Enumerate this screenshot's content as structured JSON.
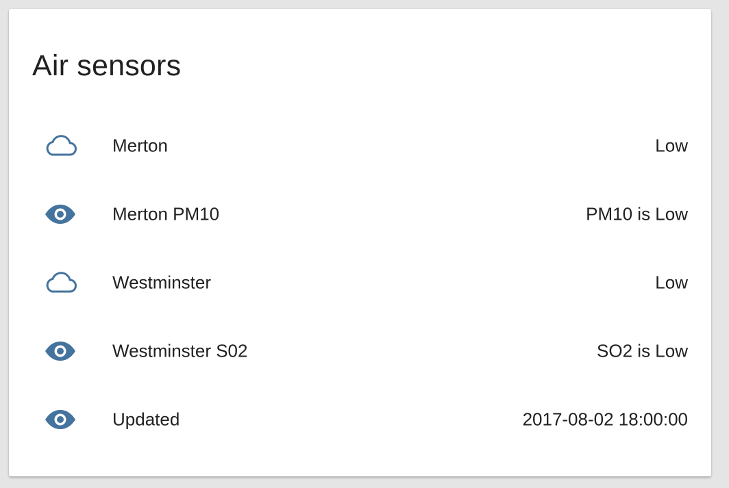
{
  "card": {
    "title": "Air sensors"
  },
  "colors": {
    "icon": "#44739e",
    "text": "#212121",
    "background": "#e5e5e5",
    "card": "#ffffff"
  },
  "rows": [
    {
      "icon": "cloud-icon",
      "name": "Merton",
      "state": "Low"
    },
    {
      "icon": "eye-icon",
      "name": "Merton PM10",
      "state": "PM10 is Low"
    },
    {
      "icon": "cloud-icon",
      "name": "Westminster",
      "state": "Low"
    },
    {
      "icon": "eye-icon",
      "name": "Westminster S02",
      "state": "SO2 is Low"
    },
    {
      "icon": "eye-icon",
      "name": "Updated",
      "state": "2017-08-02 18:00:00"
    }
  ]
}
